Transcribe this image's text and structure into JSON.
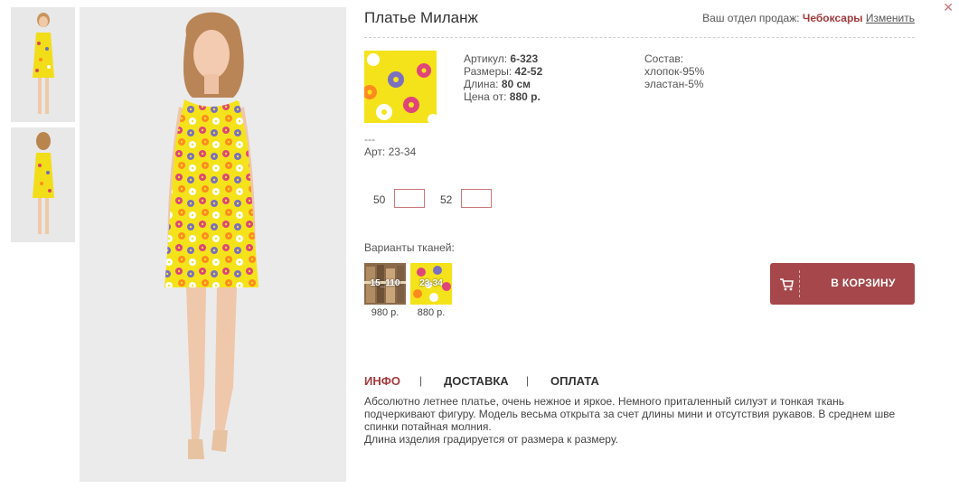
{
  "product": {
    "title": "Платье Миланж"
  },
  "department": {
    "label": "Ваш отдел продаж:",
    "city": "Чебоксары",
    "change_link": "Изменить"
  },
  "specs": {
    "article_label": "Артикул:",
    "article": "6-323",
    "sizes_label": "Размеры:",
    "sizes": "42-52",
    "length_label": "Длина:",
    "length": "80 см",
    "price_label": "Цена от:",
    "price": "880 р."
  },
  "composition": {
    "label": "Состав:",
    "lines": [
      "хлопок-95%",
      "эластан-5%"
    ]
  },
  "fabric_article": {
    "dashes": "---",
    "label": "Арт: 23-34"
  },
  "sizes": [
    {
      "label": "50",
      "qty": ""
    },
    {
      "label": "52",
      "qty": ""
    }
  ],
  "variants": {
    "label": "Варианты тканей:",
    "items": [
      {
        "code": "15_110",
        "price": "980 р."
      },
      {
        "code": "23-34",
        "price": "880 р."
      }
    ]
  },
  "cart": {
    "label": "В КОРЗИНУ",
    "icon": "cart-icon"
  },
  "tabs": {
    "items": [
      "ИНФО",
      "ДОСТАВКА",
      "ОПЛАТА"
    ],
    "separator": "|",
    "active": 0
  },
  "description": {
    "p1": "Абсолютно летнее платье, очень нежное и яркое. Немного приталенный силуэт и тонкая ткань подчеркивают фигуру. Модель весьма открыта за счет длины мини и отсутствия рукавов. В среднем шве спинки потайная молния.",
    "p2": "Длина изделия градируется от размера к размеру."
  },
  "close_glyph": "✕",
  "colors": {
    "accent": "#a5474b",
    "accent_text": "#a23a3d",
    "dress_yellow": "#f4e31b"
  }
}
